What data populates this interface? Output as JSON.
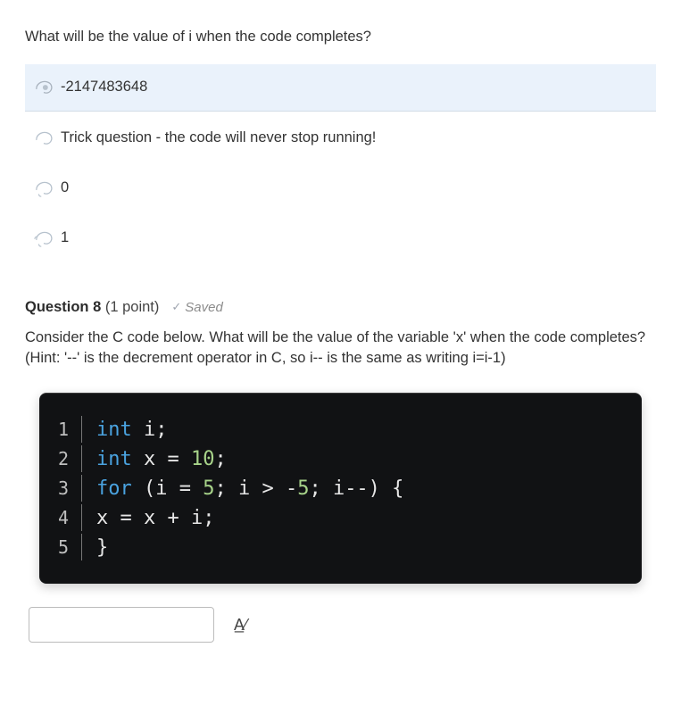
{
  "question7": {
    "title": "What will be the value of i when the code completes?",
    "options": [
      {
        "label": "-2147483648",
        "selected": true
      },
      {
        "label": "Trick question - the code will never stop running!",
        "selected": false
      },
      {
        "label": "0",
        "selected": false
      },
      {
        "label": "1",
        "selected": false
      }
    ]
  },
  "question8": {
    "header_word": "Question 8",
    "points": "(1 point)",
    "saved_label": "Saved",
    "body": "Consider the C code below. What will be the value of the variable 'x' when the code completes? (Hint: '--' is the decrement operator in C, so i-- is the same as writing i=i-1)",
    "code": {
      "lines": [
        {
          "n": "1",
          "tokens": [
            {
              "t": "int",
              "c": "kw"
            },
            {
              "t": " i;",
              "c": "id"
            }
          ]
        },
        {
          "n": "2",
          "tokens": [
            {
              "t": "int",
              "c": "kw"
            },
            {
              "t": " x = ",
              "c": "id"
            },
            {
              "t": "10",
              "c": "num"
            },
            {
              "t": ";",
              "c": "id"
            }
          ]
        },
        {
          "n": "3",
          "tokens": [
            {
              "t": "for",
              "c": "kw"
            },
            {
              "t": " (i = ",
              "c": "id"
            },
            {
              "t": "5",
              "c": "num"
            },
            {
              "t": "; i > -",
              "c": "id"
            },
            {
              "t": "5",
              "c": "num"
            },
            {
              "t": "; i--) {",
              "c": "id"
            }
          ]
        },
        {
          "n": "4",
          "tokens": [
            {
              "t": "    x = x + i;",
              "c": "id"
            }
          ]
        },
        {
          "n": "5",
          "tokens": [
            {
              "t": "}",
              "c": "id"
            }
          ]
        }
      ]
    },
    "answer_value": ""
  }
}
